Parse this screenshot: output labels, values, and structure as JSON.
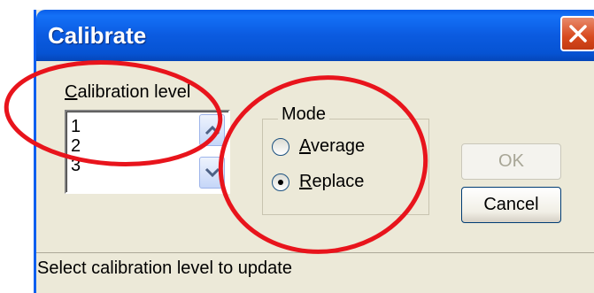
{
  "window": {
    "title": "Calibrate",
    "close_icon": "close-x-icon"
  },
  "calibration": {
    "label": "Calibration level",
    "items": [
      "1",
      "2",
      "3"
    ],
    "scroll_up_icon": "chevron-up-icon",
    "scroll_down_icon": "chevron-down-icon"
  },
  "mode": {
    "label": "Mode",
    "options": [
      {
        "label": "Average",
        "selected": false
      },
      {
        "label": "Replace",
        "selected": true
      }
    ]
  },
  "buttons": {
    "ok": "OK",
    "cancel": "Cancel",
    "ok_enabled": false
  },
  "status": {
    "text": "Select calibration level to update"
  },
  "colors": {
    "title_bar": "#0a5ee8",
    "dialog_bg": "#ece9d8",
    "annotation": "#e8141c",
    "close_button": "#d84a1e"
  }
}
